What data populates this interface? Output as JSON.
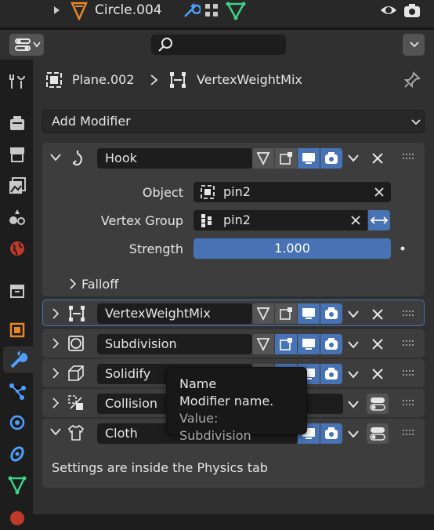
{
  "outliner": {
    "object_name": "Circle.004"
  },
  "header": {
    "search_placeholder": ""
  },
  "breadcrumb": {
    "object": "Plane.002",
    "modifier": "VertexWeightMix"
  },
  "add_modifier": {
    "label": "Add Modifier"
  },
  "modifiers": [
    {
      "name": "Hook",
      "expanded": true,
      "fields": {
        "object_label": "Object",
        "object_value": "pin2",
        "vertex_group_label": "Vertex Group",
        "vertex_group_value": "pin2",
        "strength_label": "Strength",
        "strength_value": "1.000"
      },
      "subpanel": "Falloff"
    },
    {
      "name": "VertexWeightMix",
      "expanded": false
    },
    {
      "name": "Subdivision",
      "expanded": false
    },
    {
      "name": "Solidify",
      "expanded": false
    },
    {
      "name": "Collision",
      "expanded": false
    },
    {
      "name": "Cloth",
      "expanded": true,
      "note": "Settings are inside the Physics tab"
    }
  ],
  "tooltip": {
    "title": "Name",
    "description": "Modifier name.",
    "value": "Value: Subdivision"
  },
  "colors": {
    "accent_blue": "#4772b3",
    "object_orange": "#e8862a",
    "modifier_blue": "#4da0ff",
    "data_green": "#3dd28a"
  }
}
